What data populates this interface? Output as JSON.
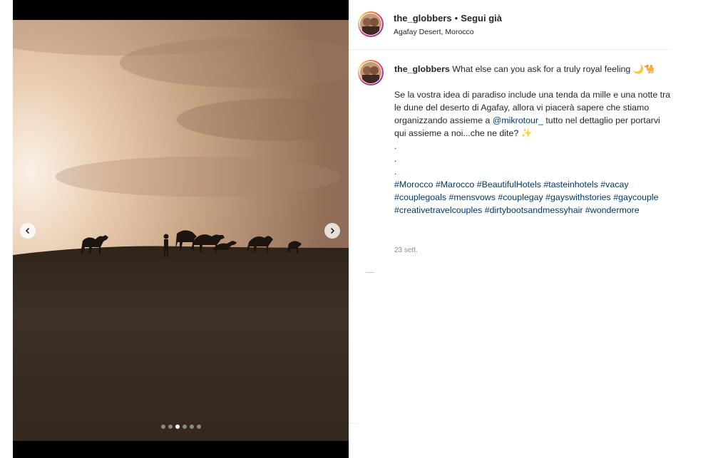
{
  "colors": {
    "link": "#00376b",
    "muted": "#8e8e8e",
    "sky_light": "#f5e6d3",
    "sky_dark": "#9c7a60",
    "dune": "#3a2e23"
  },
  "media": {
    "prev_icon": "chevron-left-icon",
    "next_icon": "chevron-right-icon",
    "slide_count": 6,
    "active_slide": 3
  },
  "header": {
    "username": "the_globbers",
    "separator": "•",
    "follow_label": "Segui già",
    "location": "Agafay Desert, Morocco"
  },
  "caption": {
    "username": "the_globbers",
    "title_text": "What else can you ask for a truly royal feeling 🌙🐪",
    "body_before_mention": "Se la vostra idea di paradiso include una tenda da mille e una notte tra le dune del deserto di Agafay, allora vi piacerà sapere che stiamo organizzando assieme a ",
    "mention": "@mikrotour_",
    "body_after_mention": " tutto nel dettaglio per portarvi qui assieme a noi...che ne dite? ✨",
    "dot1": ".",
    "dot2": ".",
    "dot3": ".",
    "hashtags": "#Morocco #Marocco #BeautifulHotels #tasteinhotels #vacay #couplegoals #mensvows #couplegay #gayswithstories #gaycouple #creativetravelcouples #dirtybootsandmessyhair #wondermore"
  },
  "timestamp": "23 sett."
}
